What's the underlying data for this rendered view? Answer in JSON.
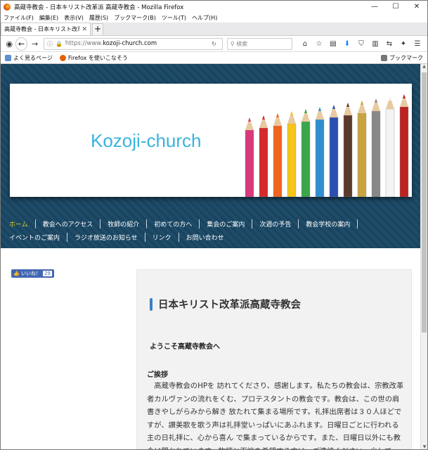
{
  "window": {
    "title": "高蔵寺教会 - 日本キリスト改革派 高蔵寺教会 - Mozilla Firefox",
    "minimize": "—",
    "maximize": "☐",
    "close": "✕"
  },
  "menu": [
    "ファイル(F)",
    "編集(E)",
    "表示(V)",
    "履歴(S)",
    "ブックマーク(B)",
    "ツール(T)",
    "ヘルプ(H)"
  ],
  "tab": {
    "label": "高蔵寺教会 - 日本キリスト改革派 高蔵",
    "close": "✕",
    "new": "+"
  },
  "nav": {
    "url_prefix": "https://www.",
    "url_domain": "kozoji-church.com",
    "search_placeholder": "検索"
  },
  "bookmarks": {
    "most_visited": "よく見るページ",
    "firefox": "Firefox を使いこなそう",
    "bookmark_menu": "ブックマーク"
  },
  "site": {
    "title": "Kozoji-church",
    "nav_row1": [
      "ホーム",
      "教会へのアクセス",
      "牧師の紹介",
      "初めての方へ",
      "集会のご案内",
      "次週の予告",
      "教会学校の案内"
    ],
    "nav_row2": [
      "イベントのご案内",
      "ラジオ放送のお知らせ",
      "リンク",
      "お問い合わせ"
    ],
    "like_label": "いいね！",
    "like_count": "29",
    "heading": "日本キリスト改革派高蔵寺教会",
    "welcome": "ようこそ高蔵寺教会へ",
    "greeting_title": "ご挨拶",
    "body_text": "　高蔵寺教会のHPを 訪れてくださり、感謝します。私たちの教会は、宗教改革者カルヴァンの流れをくむ、プロテスタントの教会です。教会は、この世の肩書きやしがらみから解き 放たれて集まる場所です。礼拝出席者は３０人ほどですが、讃美歌を歌う声は礼拝堂いっぱいにあふれます。日曜日ごとに行われる主の日礼拝に、心から喜ん で集まっているからです。また、日曜日以外にも教会は開かれています。牧師と面談を希望する方は、ご連絡ください。少しでも、あなたの助けになれれば幸いです。"
  },
  "colors": {
    "accent": "#3ab3df",
    "nav_active": "#e0d52c",
    "header_bg": "#1c4a66",
    "heading_bar": "#3a7fc1"
  }
}
